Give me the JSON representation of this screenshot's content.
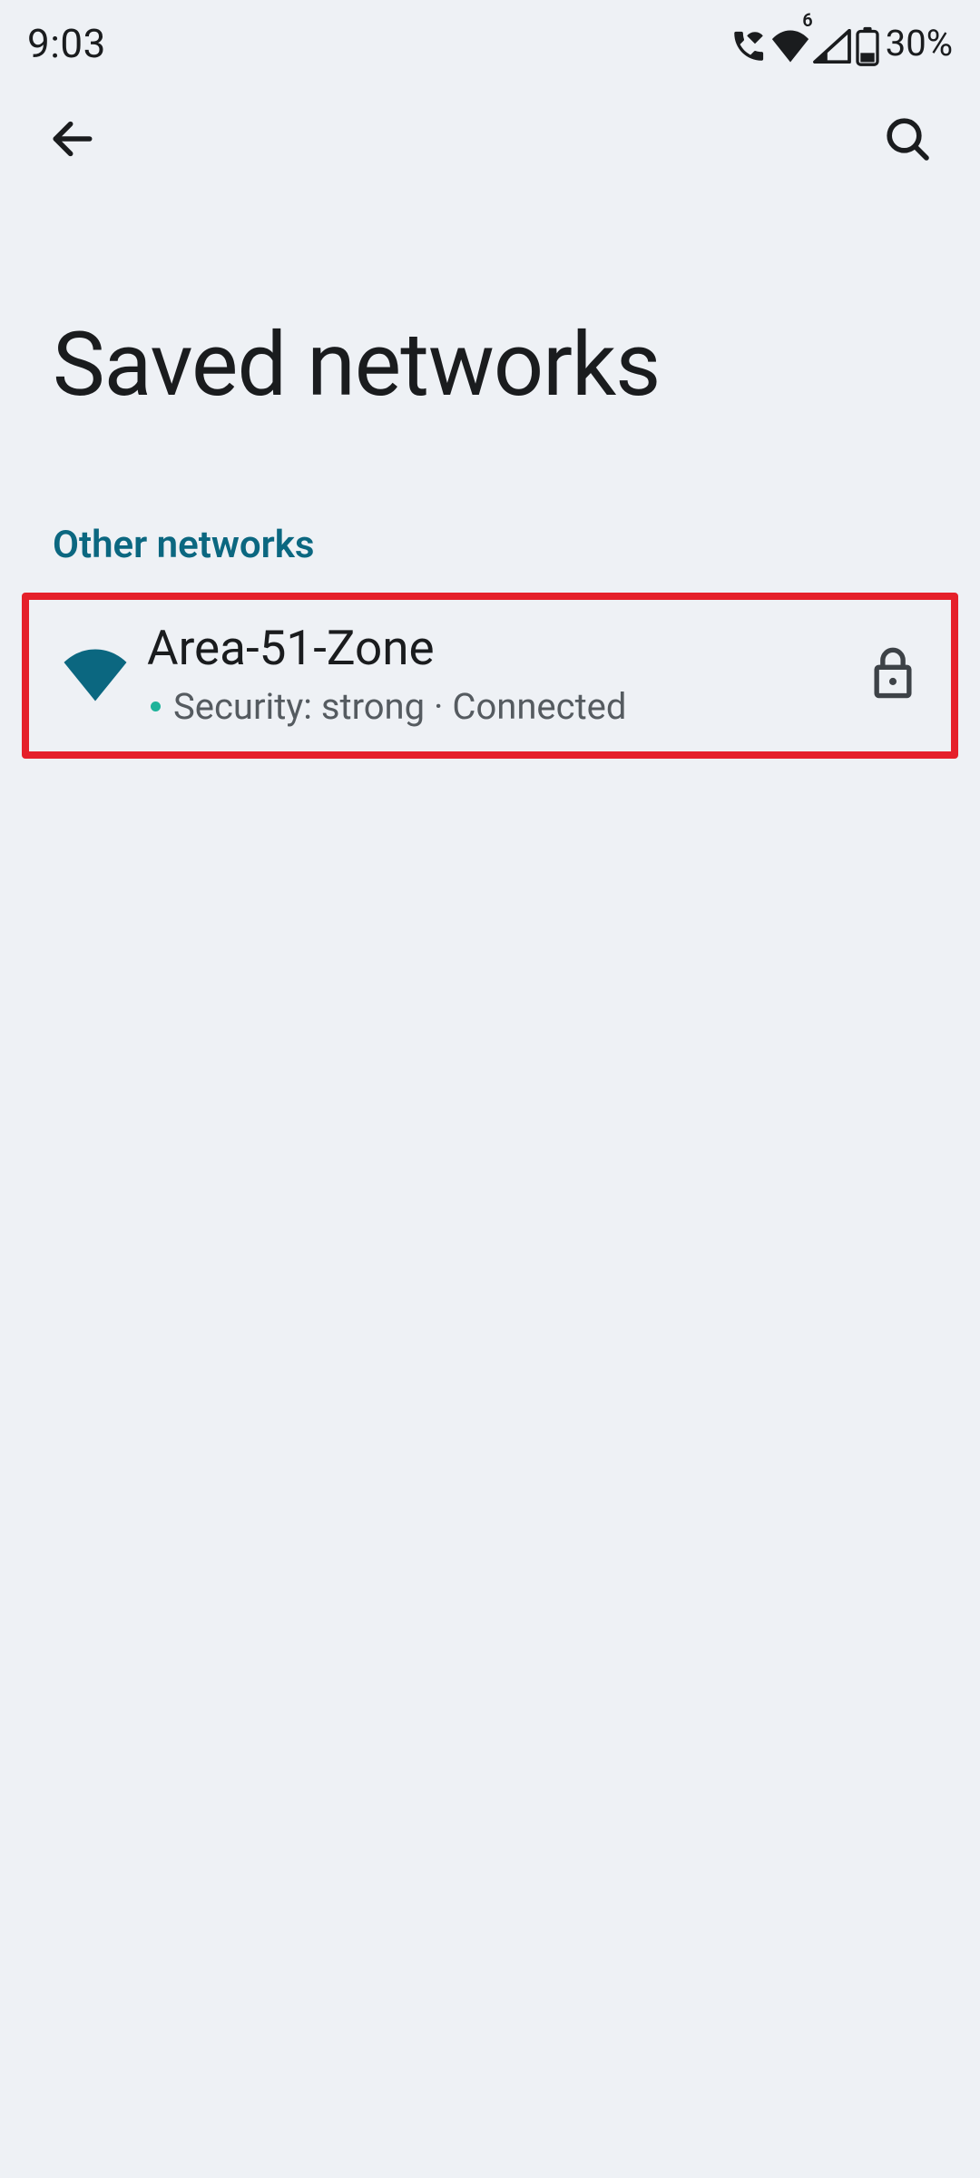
{
  "status_bar": {
    "time": "9:03",
    "battery_text": "30%",
    "wifi_badge": "6"
  },
  "header": {
    "title": "Saved networks"
  },
  "section": {
    "header": "Other networks"
  },
  "networks": [
    {
      "name": "Area-51-Zone",
      "subtitle": "Security: strong · Connected",
      "highlighted": true,
      "locked": true
    }
  ],
  "colors": {
    "accent": "#0b6780",
    "highlight": "#e5202a",
    "bg": "#eef1f5"
  }
}
